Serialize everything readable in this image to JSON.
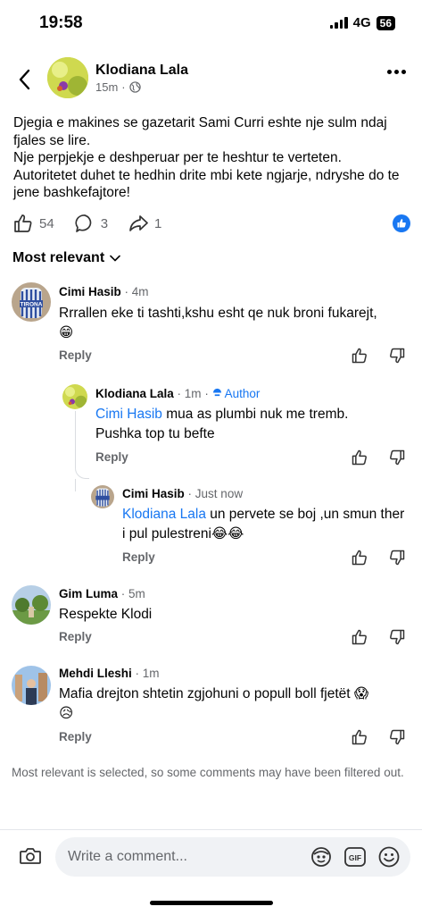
{
  "status_bar": {
    "time": "19:58",
    "network": "4G",
    "battery": "56"
  },
  "header": {
    "author_name": "Klodiana Lala",
    "time": "15m",
    "separator": "·",
    "privacy_icon": "globe-icon"
  },
  "post": {
    "lines": [
      "Djegia e makines se gazetarit Sami Curri eshte nje sulm ndaj fjales se lire.",
      "Nje perpjekje e deshperuar per te heshtur te verteten.",
      "Autoritetet duhet te hedhin drite mbi kete ngjarje, ndryshe do te jene bashkefajtore!"
    ],
    "likes": "54",
    "comments": "3",
    "shares": "1"
  },
  "sort": {
    "label": "Most relevant"
  },
  "comments": [
    {
      "author": "Cimi Hasib",
      "time": "4m",
      "text": "Rrrallen eke ti tashti,kshu esht qe nuk broni fukarejt,",
      "emoji": "😁",
      "reply_label": "Reply"
    },
    {
      "author": "Klodiana Lala",
      "time": "1m",
      "badge": "Author",
      "mention": "Cimi Hasib",
      "text": " mua as plumbi nuk me tremb. Pushka top tu befte",
      "reply_label": "Reply"
    },
    {
      "author": "Cimi Hasib",
      "time": "Just now",
      "mention": "Klodiana Lala",
      "text": " un pervete se boj ,un smun ther i pul pulestreni",
      "emoji": "😂😂",
      "reply_label": "Reply"
    },
    {
      "author": "Gim Luma",
      "time": "5m",
      "text": "Respekte Klodi",
      "reply_label": "Reply"
    },
    {
      "author": "Mehdi Lleshi",
      "time": "1m",
      "text": "Mafia drejton shtetin zgjohuni o popull boll fjetët",
      "emoji": "😱",
      "emoji2": "😥",
      "reply_label": "Reply"
    }
  ],
  "filter_note": "Most relevant is selected, so some comments may have been filtered out.",
  "composer": {
    "placeholder": "Write a comment..."
  },
  "colors": {
    "accent": "#1877f2",
    "muted": "#65676b",
    "input_bg": "#f0f2f5"
  }
}
